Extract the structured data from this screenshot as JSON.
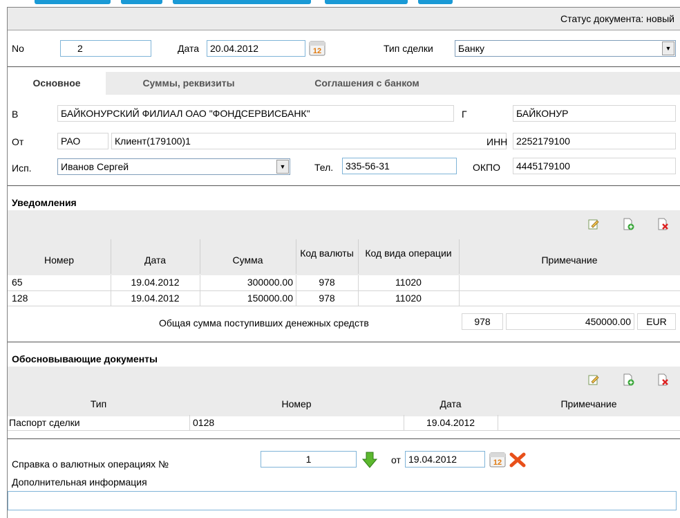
{
  "colors": {
    "accent": "#1a9ad6",
    "toolbar_bg": "#ebebeb",
    "input_border": "#7fb4d8"
  },
  "status": {
    "label": "Статус документа: новый"
  },
  "header": {
    "no_label": "No",
    "no_value": "2",
    "date_label": "Дата",
    "date_value": "20.04.2012",
    "deal_type_label": "Тип сделки",
    "deal_type_value": "Банку"
  },
  "tabs": [
    {
      "label": "Основное",
      "active": true
    },
    {
      "label": "Суммы, реквизиты",
      "active": false
    },
    {
      "label": "Соглашения с банком",
      "active": false
    }
  ],
  "main": {
    "to_label": "В",
    "to_value": "БАЙКОНУРСКИЙ ФИЛИАЛ ОАО \"ФОНДСЕРВИСБАНК\"",
    "city_label": "Г",
    "city_value": "БАЙКОНУР",
    "from_label": "От",
    "from_org": "РАО",
    "from_value": "Клиент(179100)1",
    "inn_label": "ИНН",
    "inn_value": "2252179100",
    "exec_label": "Исп.",
    "exec_value": "Иванов Сергей",
    "tel_label": "Тел.",
    "tel_value": "335-56-31",
    "okpo_label": "ОКПО",
    "okpo_value": "4445179100"
  },
  "notifications": {
    "title": "Уведомления",
    "columns": [
      "Номер",
      "Дата",
      "Сумма",
      "Код валюты",
      "Код вида операции",
      "Примечание"
    ],
    "rows": [
      {
        "number": "65",
        "date": "19.04.2012",
        "amount": "300000.00",
        "currency": "978",
        "op_code": "11020",
        "note": ""
      },
      {
        "number": "128",
        "date": "19.04.2012",
        "amount": "150000.00",
        "currency": "978",
        "op_code": "11020",
        "note": ""
      }
    ],
    "total_label": "Общая сумма поступивших денежных средств",
    "total_currency_code": "978",
    "total_amount": "450000.00",
    "total_currency": "EUR"
  },
  "documents": {
    "title": "Обосновывающие документы",
    "columns": [
      "Тип",
      "Номер",
      "Дата",
      "Примечание"
    ],
    "rows": [
      {
        "type": "Паспорт сделки",
        "number": "0128",
        "date": "19.04.2012",
        "note": ""
      }
    ]
  },
  "footer": {
    "certificate_label": "Справка о валютных операциях №",
    "certificate_number": "1",
    "from_label": "от",
    "certificate_date": "19.04.2012",
    "additional_label": "Дополнительная информация",
    "additional_value": ""
  }
}
